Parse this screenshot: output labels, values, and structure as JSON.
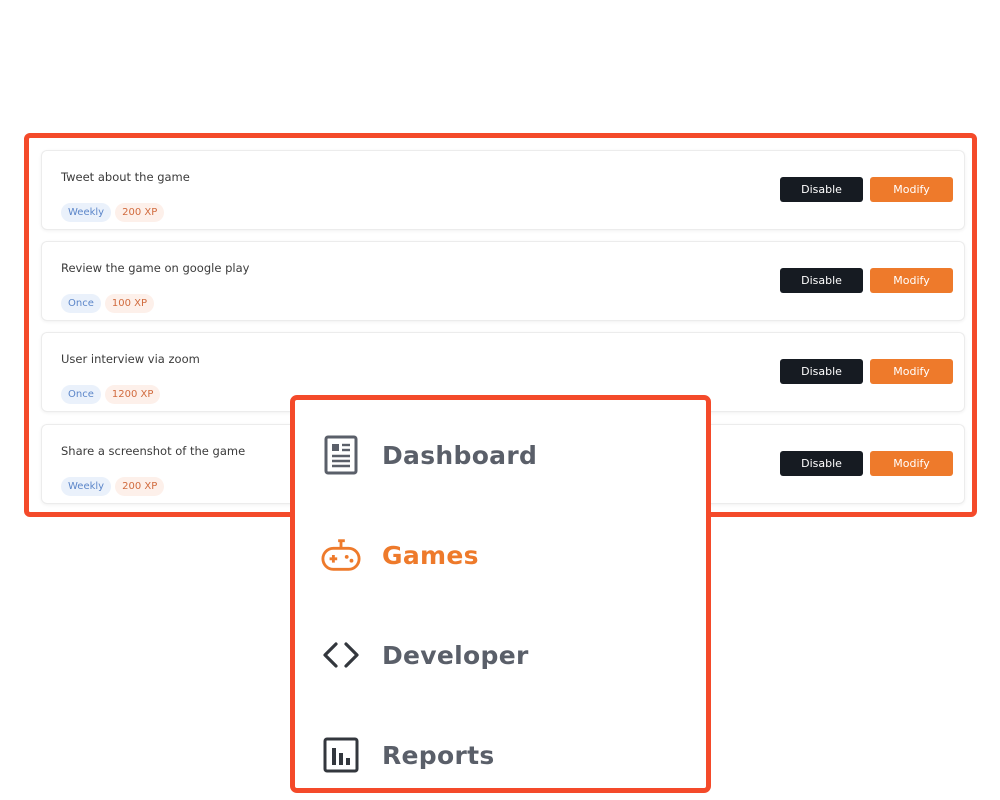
{
  "quests": [
    {
      "title": "Tweet about the game",
      "frequency": "Weekly",
      "xp": "200 XP",
      "disable_label": "Disable",
      "modify_label": "Modify"
    },
    {
      "title": "Review the game on google play",
      "frequency": "Once",
      "xp": "100 XP",
      "disable_label": "Disable",
      "modify_label": "Modify"
    },
    {
      "title": "User interview via zoom",
      "frequency": "Once",
      "xp": "1200 XP",
      "disable_label": "Disable",
      "modify_label": "Modify"
    },
    {
      "title": "Share a screenshot of the game",
      "frequency": "Weekly",
      "xp": "200 XP",
      "disable_label": "Disable",
      "modify_label": "Modify"
    }
  ],
  "nav": {
    "items": [
      {
        "label": "Dashboard",
        "icon": "dashboard-icon",
        "active": false
      },
      {
        "label": "Games",
        "icon": "gamepad-icon",
        "active": true
      },
      {
        "label": "Developer",
        "icon": "code-icon",
        "active": false
      },
      {
        "label": "Reports",
        "icon": "bar-chart-icon",
        "active": false
      }
    ]
  },
  "colors": {
    "highlight_border": "#f44a2a",
    "accent": "#ee7a2b",
    "disable_button": "#161b22",
    "nav_text": "#5a5f69",
    "freq_tag_bg": "#eaf1fb",
    "xp_tag_bg": "#fdf0ea"
  }
}
